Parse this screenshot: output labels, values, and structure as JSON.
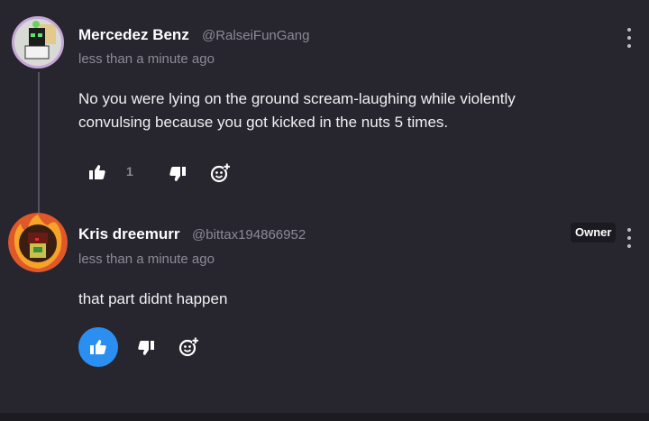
{
  "comments": [
    {
      "author": "Mercedez Benz",
      "handle": "@RalseiFunGang",
      "time": "less than a minute ago",
      "body_line1": "No you were lying on the ground scream-laughing while violently",
      "body_line2": "convulsing because you got kicked in the nuts 5 times.",
      "like_count": "1",
      "liked": false
    },
    {
      "author": "Kris dreemurr",
      "handle": "@bittax194866952",
      "badge": "Owner",
      "time": "less than a minute ago",
      "body_line1": "that part didnt happen",
      "liked": true
    }
  ],
  "colors": {
    "background": "#27252e",
    "accent": "#2b8ff2",
    "muted_text": "#8d8a95"
  },
  "icons": [
    "thumbs-up-icon",
    "thumbs-down-icon",
    "add-reaction-icon",
    "more-options-icon"
  ]
}
